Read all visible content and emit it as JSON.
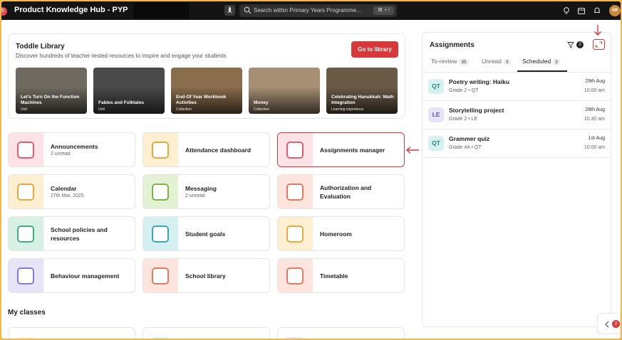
{
  "topbar": {
    "title": "Product Knowledge Hub - PYP",
    "notification_dot": "5",
    "search_placeholder": "Search within Primary Years Programme...",
    "search_shortcut": "⌘ + /",
    "avatar_initials": "SR"
  },
  "library": {
    "title": "Toddle Library",
    "subtitle": "Discover hundreds of teacher-tested resources to inspire and engage your students",
    "button_label": "Go to library",
    "cards": [
      {
        "title": "Let's Turn On the Function Machines",
        "type": "Unit",
        "bg": "#6f6a5f"
      },
      {
        "title": "Fables and Folktales",
        "type": "Unit",
        "bg": "#4a4a4a"
      },
      {
        "title": "End-Of Year Workbook Activities",
        "type": "Collection",
        "bg": "#8a6d4c"
      },
      {
        "title": "Money",
        "type": "Collection",
        "bg": "#a78f74"
      },
      {
        "title": "Celebrating Hanukkah: Math Integration",
        "type": "Learning experience",
        "bg": "#6a5a46"
      }
    ]
  },
  "tiles": [
    {
      "title": "Announcements",
      "sub": "2 unread",
      "bg": "#fde2e6",
      "accent": "#e85a70",
      "icon": "megaphone-icon"
    },
    {
      "title": "Attendance dashboard",
      "sub": "",
      "bg": "#fdf0d2",
      "accent": "#e8a93a",
      "icon": "clipboard-icon"
    },
    {
      "title": "Assignments manager",
      "sub": "",
      "bg": "#fde2e6",
      "accent": "#e85a70",
      "icon": "checklist-icon"
    },
    {
      "title": "Calendar",
      "sub": "27th Mar, 2025",
      "bg": "#fdf0d2",
      "accent": "#e8a93a",
      "icon": "calendar-icon"
    },
    {
      "title": "Messaging",
      "sub": "2 unread",
      "bg": "#e3f2d4",
      "accent": "#7cb342",
      "icon": "chat-icon"
    },
    {
      "title": "Authorization and Evaluation",
      "sub": "",
      "bg": "#fde4dc",
      "accent": "#e57a5a",
      "icon": "document-badge-icon"
    },
    {
      "title": "School policies and resources",
      "sub": "",
      "bg": "#d8f1e6",
      "accent": "#3fae7e",
      "icon": "policy-doc-icon"
    },
    {
      "title": "Student goals",
      "sub": "",
      "bg": "#d6f0f2",
      "accent": "#3aa7b4",
      "icon": "target-icon"
    },
    {
      "title": "Homeroom",
      "sub": "",
      "bg": "#fdf0d2",
      "accent": "#e8a93a",
      "icon": "backpack-icon"
    },
    {
      "title": "Behaviour management",
      "sub": "",
      "bg": "#e8e4f8",
      "accent": "#8a78d8",
      "icon": "heart-head-icon"
    },
    {
      "title": "School library",
      "sub": "",
      "bg": "#fde4dc",
      "accent": "#e57a5a",
      "icon": "books-icon"
    },
    {
      "title": "Timetable",
      "sub": "",
      "bg": "#fde4dc",
      "accent": "#e57a5a",
      "icon": "timetable-icon"
    }
  ],
  "my_classes": "My classes",
  "assignments": {
    "title": "Assignments",
    "filter_count": "2",
    "tabs": [
      {
        "label": "To-review",
        "count": "35"
      },
      {
        "label": "Unread",
        "count": "3"
      },
      {
        "label": "Scheduled",
        "count": "3"
      }
    ],
    "items": [
      {
        "badge": "QT",
        "badge_bg": "#d6f2f0",
        "badge_fg": "#2a7f7a",
        "title": "Poetry writing: Haiku",
        "meta": "Grade 2 • QT",
        "date": "29th Aug",
        "time": "10:00 am"
      },
      {
        "badge": "LE",
        "badge_bg": "#e6e4fb",
        "badge_fg": "#5b53b8",
        "title": "Storytelling project",
        "meta": "Grade 2 • LE",
        "date": "28th Aug",
        "time": "10.30 am"
      },
      {
        "badge": "QT",
        "badge_bg": "#d6f2f0",
        "badge_fg": "#2a7f7a",
        "title": "Grammer quiz",
        "meta": "Grade 4A • QT",
        "date": "1st Aug",
        "time": "10:00 am"
      }
    ]
  },
  "collapse_badge": "2",
  "colors": {
    "brand_red": "#d9383a",
    "frame": "#f3b84a"
  }
}
